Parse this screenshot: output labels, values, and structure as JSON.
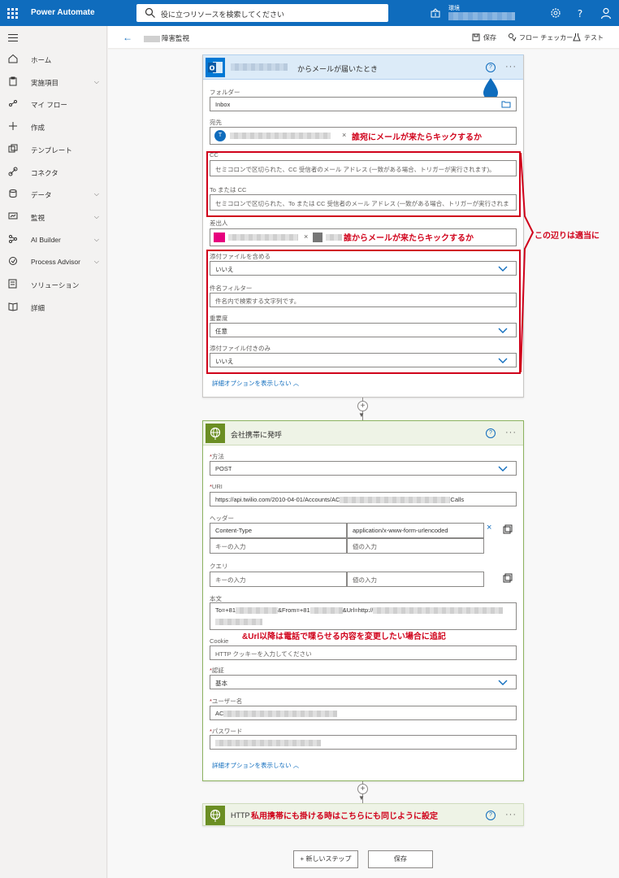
{
  "app": {
    "title": "Power Automate"
  },
  "search": {
    "placeholder": "役に立つリソースを検索してください"
  },
  "env": {
    "label": "環境"
  },
  "sidebar": {
    "items": [
      {
        "label": "ホーム",
        "icon": "home-icon",
        "chevron": false
      },
      {
        "label": "実施項目",
        "icon": "clipboard-icon",
        "chevron": true
      },
      {
        "label": "マイ フロー",
        "icon": "flow-icon",
        "chevron": false
      },
      {
        "label": "作成",
        "icon": "plus-icon",
        "chevron": false
      },
      {
        "label": "テンプレート",
        "icon": "template-icon",
        "chevron": false
      },
      {
        "label": "コネクタ",
        "icon": "connector-icon",
        "chevron": false
      },
      {
        "label": "データ",
        "icon": "database-icon",
        "chevron": true
      },
      {
        "label": "監視",
        "icon": "monitor-icon",
        "chevron": true
      },
      {
        "label": "AI Builder",
        "icon": "ai-builder-icon",
        "chevron": true
      },
      {
        "label": "Process Advisor",
        "icon": "process-advisor-icon",
        "chevron": true
      },
      {
        "label": "ソリューション",
        "icon": "solution-icon",
        "chevron": false
      },
      {
        "label": "詳細",
        "icon": "book-icon",
        "chevron": false
      }
    ]
  },
  "cmdbar": {
    "flow_name": "障害監視",
    "save": "保存",
    "checker": "フロー チェッカー",
    "test": "テスト"
  },
  "trigger": {
    "title": "からメールが届いたとき",
    "folder_label": "フォルダー",
    "folder_value": "Inbox",
    "to_label": "宛先",
    "to_avatar": "T",
    "cc_label": "CC",
    "cc_placeholder": "セミコロンで区切られた、CC 受信者のメール アドレス (一致がある場合、トリガーが実行されます)。",
    "tocc_label": "To または CC",
    "tocc_placeholder": "セミコロンで区切られた、To または CC 受信者のメール アドレス (一致がある場合、トリガーが実行されま",
    "from_label": "差出人",
    "attach_label": "添付ファイルを含める",
    "attach_value": "いいえ",
    "subject_label": "件名フィルター",
    "subject_placeholder": "件名内で検索する文字列です。",
    "importance_label": "重要度",
    "importance_value": "任意",
    "only_attach_label": "添付ファイル付きのみ",
    "only_attach_value": "いいえ",
    "advanced_link": "詳細オプションを表示しない"
  },
  "http": {
    "title": "会社携帯に発呼",
    "method_label": "方法",
    "method_value": "POST",
    "uri_label": "URI",
    "uri_value_prefix": "https://api.twilio.com/2010-04-01/Accounts/AC",
    "uri_value_suffix": "Calls",
    "headers_label": "ヘッダー",
    "header_key": "Content-Type",
    "header_value": "application/x-www-form-urlencoded",
    "key_placeholder": "キーの入力",
    "value_placeholder": "値の入力",
    "query_label": "クエリ",
    "body_label": "本文",
    "body_value_1": "To=+81",
    "body_value_2": "&From=+81",
    "body_value_3": "&Url=http://",
    "cookie_label": "Cookie",
    "cookie_placeholder": "HTTP クッキーを入力してください",
    "auth_label": "認証",
    "auth_value": "基本",
    "user_label": "ユーザー名",
    "user_value_prefix": "AC",
    "password_label": "パスワード",
    "advanced_link": "詳細オプションを表示しない"
  },
  "http2": {
    "title": "HTTP"
  },
  "footer": {
    "new_step": "+ 新しいステップ",
    "save": "保存"
  },
  "annotations": {
    "to_note": "誰宛にメールが来たらキックするか",
    "from_note": "誰からメールが来たらキックするか",
    "side_note": "この辺りは適当に",
    "body_note": "&Url以降は電話で喋らせる内容を変更したい場合に追記",
    "http2_note": "私用携帯にも掛ける時はこちらにも同じように設定"
  },
  "colors": {
    "brand": "#0f6cbd",
    "annotation": "#d0021b",
    "http_accent": "#6b8e23",
    "outlook": "#0078d4"
  }
}
